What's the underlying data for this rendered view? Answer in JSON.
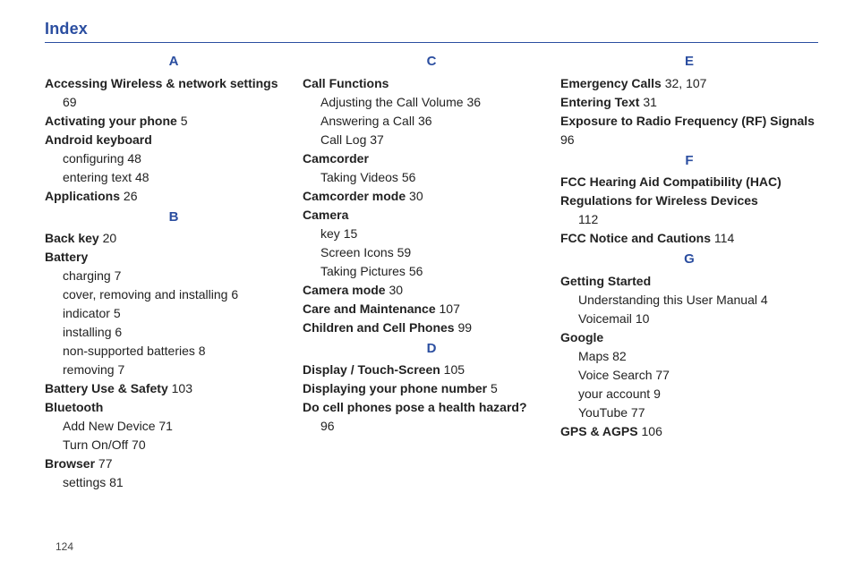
{
  "title": "Index",
  "page_number": "124",
  "columns": [
    {
      "blocks": [
        {
          "type": "letter",
          "text": "A"
        },
        {
          "type": "entry",
          "label": "Accessing Wireless & network settings",
          "page": ""
        },
        {
          "type": "sub",
          "label": "69",
          "page": ""
        },
        {
          "type": "entry",
          "label": "Activating your phone",
          "page": "5"
        },
        {
          "type": "entry",
          "label": "Android keyboard",
          "page": ""
        },
        {
          "type": "sub",
          "label": "configuring",
          "page": "48"
        },
        {
          "type": "sub",
          "label": "entering text",
          "page": "48"
        },
        {
          "type": "entry",
          "label": "Applications",
          "page": "26"
        },
        {
          "type": "letter",
          "text": "B"
        },
        {
          "type": "entry",
          "label": "Back key",
          "page": "20"
        },
        {
          "type": "entry",
          "label": "Battery",
          "page": ""
        },
        {
          "type": "sub",
          "label": "charging",
          "page": "7"
        },
        {
          "type": "sub",
          "label": "cover, removing and installing",
          "page": "6"
        },
        {
          "type": "sub",
          "label": "indicator",
          "page": "5"
        },
        {
          "type": "sub",
          "label": "installing",
          "page": "6"
        },
        {
          "type": "sub",
          "label": "non-supported batteries",
          "page": "8"
        },
        {
          "type": "sub",
          "label": "removing",
          "page": "7"
        },
        {
          "type": "entry",
          "label": "Battery Use & Safety",
          "page": "103"
        },
        {
          "type": "entry",
          "label": "Bluetooth",
          "page": ""
        },
        {
          "type": "sub",
          "label": "Add New Device",
          "page": "71"
        },
        {
          "type": "sub",
          "label": "Turn On/Off",
          "page": "70"
        },
        {
          "type": "entry",
          "label": "Browser",
          "page": "77"
        },
        {
          "type": "sub",
          "label": "settings",
          "page": "81"
        }
      ]
    },
    {
      "blocks": [
        {
          "type": "letter",
          "text": "C"
        },
        {
          "type": "entry",
          "label": "Call Functions",
          "page": ""
        },
        {
          "type": "sub",
          "label": "Adjusting the Call Volume",
          "page": "36"
        },
        {
          "type": "sub",
          "label": "Answering a Call",
          "page": "36"
        },
        {
          "type": "sub",
          "label": "Call Log",
          "page": "37"
        },
        {
          "type": "entry",
          "label": "Camcorder",
          "page": ""
        },
        {
          "type": "sub",
          "label": "Taking Videos",
          "page": "56"
        },
        {
          "type": "entry",
          "label": "Camcorder mode",
          "page": "30"
        },
        {
          "type": "entry",
          "label": "Camera",
          "page": ""
        },
        {
          "type": "sub",
          "label": "key",
          "page": "15"
        },
        {
          "type": "sub",
          "label": "Screen Icons",
          "page": "59"
        },
        {
          "type": "sub",
          "label": "Taking Pictures",
          "page": "56"
        },
        {
          "type": "entry",
          "label": "Camera mode",
          "page": "30"
        },
        {
          "type": "entry",
          "label": "Care and Maintenance",
          "page": "107"
        },
        {
          "type": "entry",
          "label": "Children and Cell Phones",
          "page": "99"
        },
        {
          "type": "letter",
          "text": "D"
        },
        {
          "type": "entry",
          "label": "Display / Touch-Screen",
          "page": "105"
        },
        {
          "type": "entry",
          "label": "Displaying your phone number",
          "page": "5"
        },
        {
          "type": "entry",
          "label": "Do cell phones pose a health hazard?",
          "page": ""
        },
        {
          "type": "sub",
          "label": "96",
          "page": ""
        }
      ]
    },
    {
      "blocks": [
        {
          "type": "letter",
          "text": "E"
        },
        {
          "type": "entry",
          "label": "Emergency Calls",
          "page": "32, 107"
        },
        {
          "type": "entry",
          "label": "Entering Text",
          "page": "31"
        },
        {
          "type": "entry",
          "label": "Exposure to Radio Frequency (RF) Signals",
          "page": "96"
        },
        {
          "type": "letter",
          "text": "F"
        },
        {
          "type": "entry",
          "label": "FCC Hearing Aid Compatibility (HAC) Regulations for Wireless Devices",
          "page": ""
        },
        {
          "type": "sub",
          "label": "112",
          "page": ""
        },
        {
          "type": "entry",
          "label": "FCC Notice and Cautions",
          "page": "114"
        },
        {
          "type": "letter",
          "text": "G"
        },
        {
          "type": "entry",
          "label": "Getting Started",
          "page": ""
        },
        {
          "type": "sub",
          "label": "Understanding this User Manual",
          "page": "4"
        },
        {
          "type": "sub",
          "label": "Voicemail",
          "page": "10"
        },
        {
          "type": "entry",
          "label": "Google",
          "page": ""
        },
        {
          "type": "sub",
          "label": "Maps",
          "page": "82"
        },
        {
          "type": "sub",
          "label": "Voice Search",
          "page": "77"
        },
        {
          "type": "sub",
          "label": "your account",
          "page": "9"
        },
        {
          "type": "sub",
          "label": "YouTube",
          "page": "77"
        },
        {
          "type": "entry",
          "label": "GPS & AGPS",
          "page": "106"
        }
      ]
    }
  ]
}
